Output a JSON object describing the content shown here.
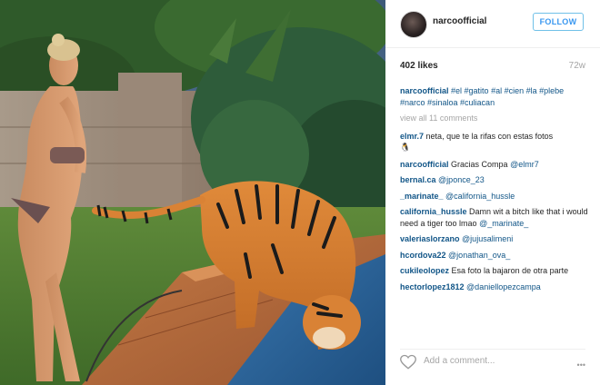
{
  "header": {
    "username": "narcoofficial",
    "follow_label": "FOLLOW"
  },
  "stats": {
    "likes": "402 likes",
    "age": "72w"
  },
  "caption": {
    "user": "narcoofficial",
    "hashtags": "#el #gatito #al #cien #la #plebe #narco #sinaloa #culiacan"
  },
  "view_all": "view all 11 comments",
  "comments": [
    {
      "user": "elmr.7",
      "text": "neta, que te la rifas con estas fotos",
      "emoji": "🐧"
    },
    {
      "user": "narcoofficial",
      "text": "Gracias Compa",
      "mention": "@elmr7"
    },
    {
      "user": "bernal.ca",
      "text": "",
      "mention": "@jponce_23"
    },
    {
      "user": "_marinate_",
      "text": "",
      "mention": "@california_hussle"
    },
    {
      "user": "california_hussle",
      "text": "Damn wit a bitch like that i would need a tiger too lmao",
      "mention": "@_marinate_"
    },
    {
      "user": "valeriaslorzano",
      "text": "",
      "mention": "@jujusalimeni"
    },
    {
      "user": "hcordova22",
      "text": "",
      "mention": "@jonathan_ova_"
    },
    {
      "user": "cukileolopez",
      "text": "Esa foto la bajaron de otra parte"
    },
    {
      "user": "hectorlopez1812",
      "text": "",
      "mention": "@daniellopezcampa"
    }
  ],
  "footer": {
    "add_comment_placeholder": "Add a comment...",
    "more_label": "•••"
  },
  "icons": {
    "heart": "heart-icon",
    "more": "ellipsis-icon",
    "emoji": "penguin-emoji-icon"
  },
  "colors": {
    "link": "#125688",
    "follow": "#3897f0",
    "muted": "#a5a5a5"
  }
}
